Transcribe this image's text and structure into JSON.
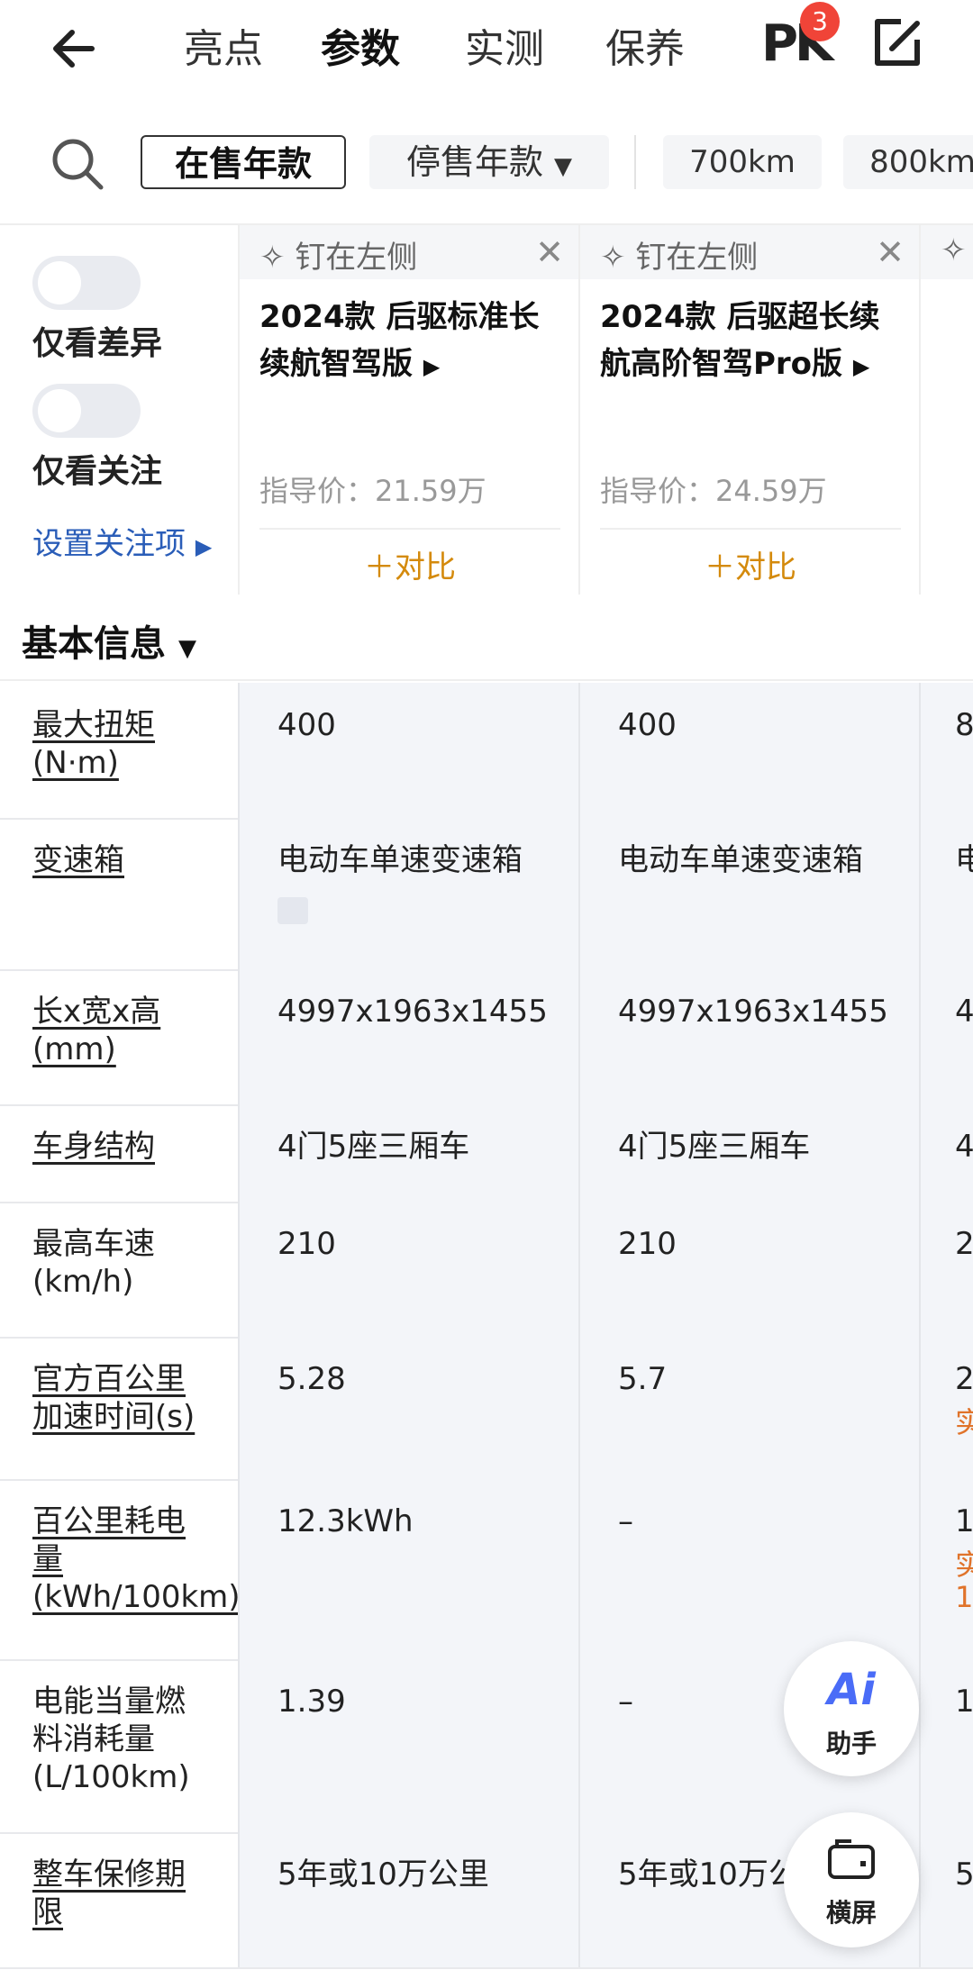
{
  "nav": {
    "tabs": [
      "亮点",
      "参数",
      "实测",
      "保养"
    ],
    "active_tab": "参数",
    "pk_label": "PK",
    "pk_count": "3"
  },
  "filter": {
    "selected": "在售年款",
    "dropdown": "停售年款",
    "range1": "700km",
    "range2": "800km"
  },
  "sidebar": {
    "only_diff": "仅看差异",
    "only_focus": "仅看关注",
    "set_focus": "设置关注项"
  },
  "cars": [
    {
      "pin": "钉在左侧",
      "name": "2024款 后驱标准长续航智驾版",
      "price": "指导价：21.59万",
      "add": "＋对比"
    },
    {
      "pin": "钉在左侧",
      "name": "2024款 后驱超长续航高阶智驾Pro版",
      "price": "指导价：24.59万",
      "add": "＋对比"
    }
  ],
  "section": {
    "title": "基本信息"
  },
  "rows": [
    {
      "label": "最大扭矩(N·m)",
      "v1": "400",
      "v2": "400",
      "v3": "8"
    },
    {
      "label": "变速箱",
      "v1": "电动车单速变速箱",
      "v2": "电动车单速变速箱",
      "v3": "电"
    },
    {
      "label": "长x宽x高(mm)",
      "v1": "4997x1963x1455",
      "v2": "4997x1963x1455",
      "v3": "4"
    },
    {
      "label": "车身结构",
      "v1": "4门5座三厢车",
      "v2": "4门5座三厢车",
      "v3": "4"
    },
    {
      "label": "最高车速(km/h)",
      "v1": "210",
      "v2": "210",
      "v3": "2"
    },
    {
      "label": "官方百公里加速时间(s)",
      "v1": "5.28",
      "v2": "5.7",
      "v3": "2",
      "v3_sub": "实"
    },
    {
      "label": "百公里耗电量(kWh/100km)",
      "v1": "12.3kWh",
      "v2": "–",
      "v3": "1",
      "v3_sub": "实",
      "v3_sub2": "1"
    },
    {
      "label": "电能当量燃料消耗量(L/100km)",
      "v1": "1.39",
      "v2": "–",
      "v3": "1"
    },
    {
      "label": "整车保修期限",
      "v1": "5年或10万公里",
      "v2": "5年或10万公里",
      "v3": "5"
    }
  ],
  "fabs": {
    "ai_icon": "Ai",
    "ai_label": "助手",
    "rotate_label": "横屏"
  }
}
